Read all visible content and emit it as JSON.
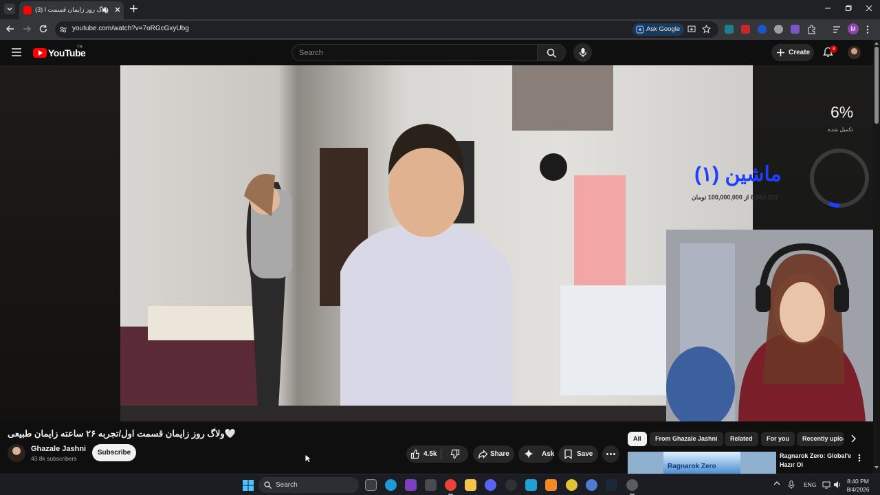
{
  "browser": {
    "tab_title": "ولاگ روز زایمان قسمت ا (3)",
    "url": "youtube.com/watch?v=7oRGcGxyUbg",
    "ask_google_label": "Ask Google",
    "profile_initial": "M"
  },
  "youtube": {
    "logo_text": "YouTube",
    "country_code": "TR",
    "search_placeholder": "Search",
    "create_label": "Create",
    "notification_count": "3"
  },
  "overlay": {
    "donation_title": "ماشین (۱)",
    "donation_progress": "6,093,222 از 100,000,000 تومان",
    "donation_percent": "6%",
    "donation_percent_value": 0.06,
    "donation_status": "تکمیل شده"
  },
  "video": {
    "title": "🤍ولاگ روز زایمان قسمت اول/تجربه ۲۶ ساعته زایمان طبیعی",
    "channel": "Ghazale Jashni",
    "subscribers": "43.8k subscribers",
    "subscribe_label": "Subscribe",
    "likes": "4.5k",
    "share_label": "Share",
    "ask_label": "Ask",
    "save_label": "Save"
  },
  "chips": [
    "All",
    "From Ghazale Jashni",
    "Related",
    "For you",
    "Recently uploaded"
  ],
  "recommendation": {
    "title": "Ragnarok Zero: Global'e Hazır Ol",
    "thumb_text": "Ragnarok Zero"
  },
  "taskbar": {
    "search_label": "Search",
    "language": "ENG",
    "time": "8:40 PM",
    "date": "8/4/2026"
  },
  "colors": {
    "youtube_red": "#ff0000",
    "donation_blue": "#1e3fff",
    "background": "#0f0f0f"
  }
}
